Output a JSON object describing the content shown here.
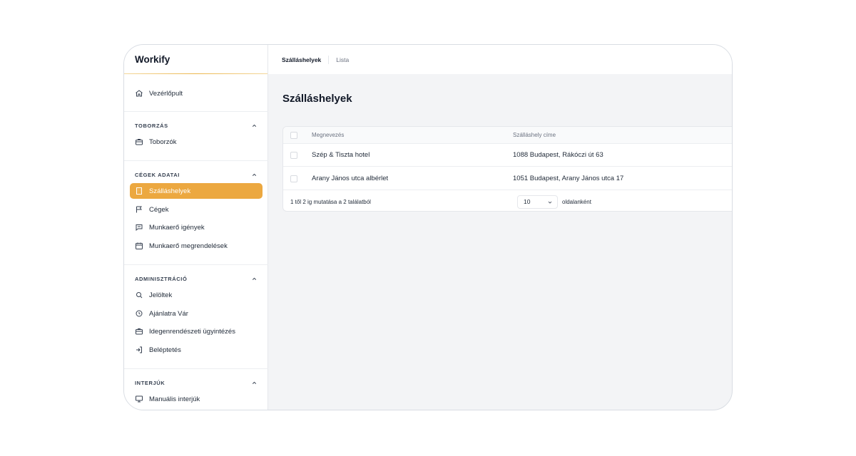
{
  "app": {
    "name": "Workify"
  },
  "breadcrumb": {
    "current": "Szálláshelyek",
    "next": "Lista"
  },
  "sidebar": {
    "top_item": {
      "label": "Vezérlőpult",
      "icon": "home-icon"
    },
    "groups": [
      {
        "title": "TOBORZÁS",
        "items": [
          {
            "label": "Toborzók",
            "icon": "briefcase-icon"
          }
        ]
      },
      {
        "title": "CÉGEK ADATAI",
        "items": [
          {
            "label": "Szálláshelyek",
            "icon": "building-icon",
            "active": true
          },
          {
            "label": "Cégek",
            "icon": "flag-icon"
          },
          {
            "label": "Munkaerő igények",
            "icon": "chat-icon"
          },
          {
            "label": "Munkaerő megrendelések",
            "icon": "calendar-icon"
          }
        ]
      },
      {
        "title": "ADMINISZTRÁCIÓ",
        "items": [
          {
            "label": "Jelöltek",
            "icon": "search-icon"
          },
          {
            "label": "Ajánlatra Vár",
            "icon": "clock-icon"
          },
          {
            "label": "Idegenrendészeti ügyintézés",
            "icon": "briefcase-icon"
          },
          {
            "label": "Beléptetés",
            "icon": "login-icon"
          }
        ]
      },
      {
        "title": "INTERJÚK",
        "items": [
          {
            "label": "Manuális interjúk",
            "icon": "monitor-icon"
          }
        ]
      }
    ]
  },
  "main": {
    "title": "Szálláshelyek",
    "table": {
      "columns": [
        "Megnevezés",
        "Szálláshely címe"
      ],
      "rows": [
        {
          "name": "Szép & Tiszta hotel",
          "address": "1088 Budapest, Rákóczi út 63"
        },
        {
          "name": "Arany János utca albérlet",
          "address": "1051 Budapest, Arany János utca 17"
        }
      ],
      "footer": {
        "count_text": "1 től 2 ig mutatása a 2 találatból",
        "per_page_value": "10",
        "per_page_label": "oldalanként"
      }
    }
  },
  "colors": {
    "accent": "#eca840",
    "background": "#f3f4f6"
  }
}
